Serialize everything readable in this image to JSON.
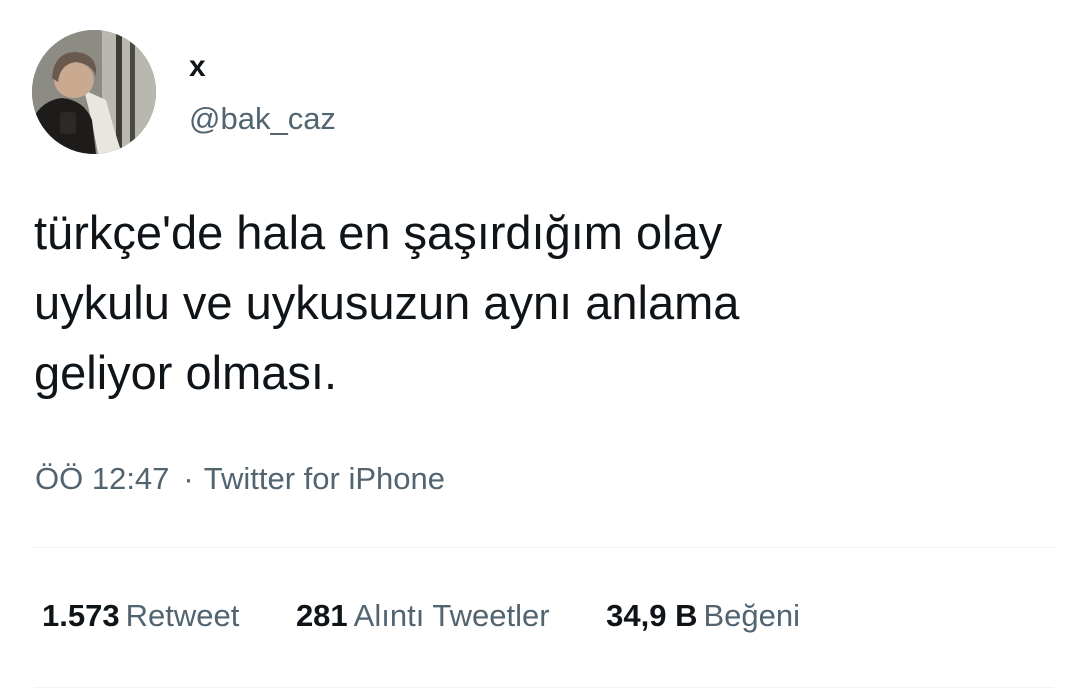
{
  "author": {
    "display_name": "x",
    "handle": "@bak_caz",
    "avatar_icon": "profile-photo"
  },
  "tweet": {
    "text": "türkçe'de hala en şaşırdığım olay\nuykulu ve uykusuzun aynı anlama\ngeliyor olması."
  },
  "meta": {
    "time": "ÖÖ 12:47",
    "separator": "·",
    "source": "Twitter for iPhone"
  },
  "stats": [
    {
      "count": "1.573",
      "label": "Retweet"
    },
    {
      "count": "281",
      "label": "Alıntı Tweetler"
    },
    {
      "count": "34,9 B",
      "label": "Beğeni"
    }
  ],
  "colors": {
    "primary_text": "#0f1419",
    "secondary_text": "#536471",
    "divider": "#eff3f4"
  }
}
